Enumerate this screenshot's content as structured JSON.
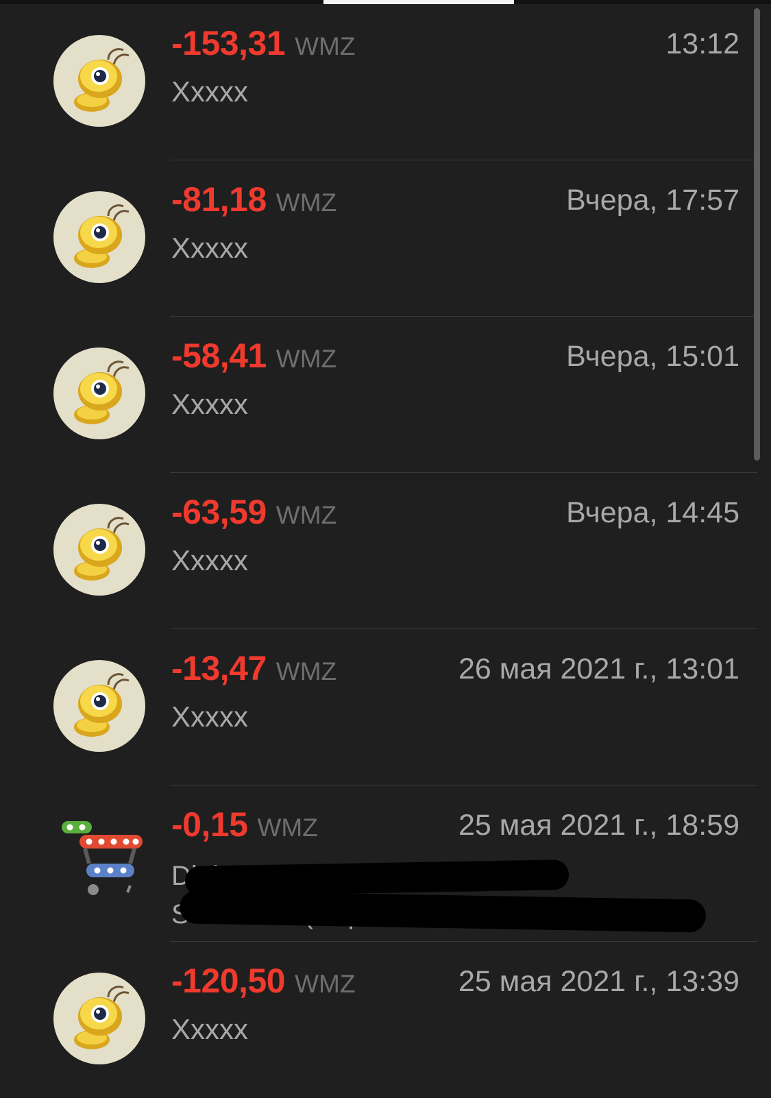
{
  "colors": {
    "negative_amount": "#f03a2e",
    "secondary_text": "#a8a8a8",
    "background": "#1f1f1f"
  },
  "transactions": [
    {
      "amount": "-153,31",
      "currency": "WMZ",
      "time": "13:12",
      "desc": "Xxxxx",
      "icon": "webmoney-ant-icon"
    },
    {
      "amount": "-81,18",
      "currency": "WMZ",
      "time": "Вчера, 17:57",
      "desc": "Xxxxx",
      "icon": "webmoney-ant-icon"
    },
    {
      "amount": "-58,41",
      "currency": "WMZ",
      "time": "Вчера, 15:01",
      "desc": "Xxxxx",
      "icon": "webmoney-ant-icon"
    },
    {
      "amount": "-63,59",
      "currency": "WMZ",
      "time": "Вчера, 14:45",
      "desc": "Xxxxx",
      "icon": "webmoney-ant-icon"
    },
    {
      "amount": "-13,47",
      "currency": "WMZ",
      "time": "26 мая 2021 г., 13:01",
      "desc": "Xxxxx",
      "icon": "webmoney-ant-icon"
    },
    {
      "amount": "-0,15",
      "currency": "WMZ",
      "time": "25 мая 2021 г., 18:59",
      "desc_line1": "Digi...",
      "desc_line2": "S... WMID (Deposit a...",
      "icon": "shopping-cart-icon"
    },
    {
      "amount": "-120,50",
      "currency": "WMZ",
      "time": "25 мая 2021 г., 13:39",
      "desc": "Xxxxx",
      "icon": "webmoney-ant-icon"
    }
  ]
}
